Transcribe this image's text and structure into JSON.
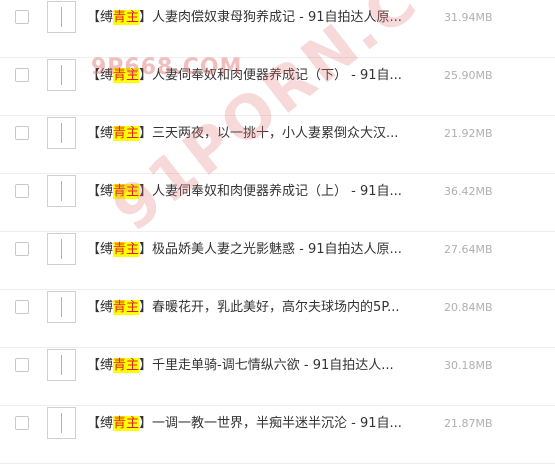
{
  "files": [
    {
      "tag_open": "【缚",
      "tag_hl": "青主",
      "tag_close": "】",
      "name": "人妻肉偿奴隶母狗养成记 - 91自拍达人原...",
      "size": "31.94MB"
    },
    {
      "tag_open": "【缚",
      "tag_hl": "青主",
      "tag_close": "】",
      "name": "人妻伺奉奴和肉便器养成记（下） - 91自...",
      "size": "25.90MB"
    },
    {
      "tag_open": "【缚",
      "tag_hl": "青主",
      "tag_close": "】",
      "name": "三天两夜，以一挑十，小人妻累倒众大汉...",
      "size": "21.92MB"
    },
    {
      "tag_open": "【缚",
      "tag_hl": "青主",
      "tag_close": "】",
      "name": "人妻伺奉奴和肉便器养成记（上） - 91自...",
      "size": "36.42MB"
    },
    {
      "tag_open": "【缚",
      "tag_hl": "青主",
      "tag_close": "】",
      "name": "极品娇美人妻之光影魅惑 - 91自拍达人原...",
      "size": "27.64MB"
    },
    {
      "tag_open": "【缚",
      "tag_hl": "青主",
      "tag_close": "】",
      "name": "春暖花开，乳此美好，高尔夫球场内的5P...",
      "size": "20.84MB"
    },
    {
      "tag_open": "【缚",
      "tag_hl": "青主",
      "tag_close": "】",
      "name": "千里走单骑-调七情纵六欲 - 91自拍达人...",
      "size": "30.18MB"
    },
    {
      "tag_open": "【缚",
      "tag_hl": "青主",
      "tag_close": "】",
      "name": "一调一教一世界，半痴半迷半沉沦 - 91自...",
      "size": "21.87MB"
    }
  ],
  "watermarks": {
    "top": "9P668.COM",
    "diagonal": "91PORN.COM"
  }
}
